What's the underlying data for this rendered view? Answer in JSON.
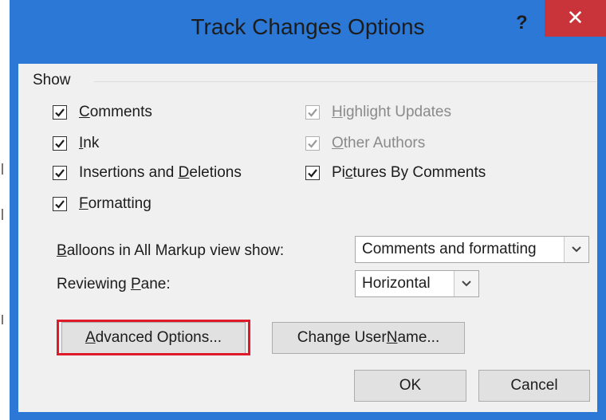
{
  "dialog": {
    "title": "Track Changes Options",
    "help_label": "?",
    "close_label": "✕"
  },
  "show_group": {
    "label": "Show",
    "checkboxes": [
      {
        "pre": "",
        "key": "C",
        "post": "omments",
        "checked": true,
        "enabled": true
      },
      {
        "pre": "",
        "key": "I",
        "post": "nk",
        "checked": true,
        "enabled": true
      },
      {
        "pre": "Insertions and ",
        "key": "D",
        "post": "eletions",
        "checked": true,
        "enabled": true
      },
      {
        "pre": "",
        "key": "F",
        "post": "ormatting",
        "checked": true,
        "enabled": true
      },
      {
        "pre": "",
        "key": "H",
        "post": "ighlight Updates",
        "checked": true,
        "enabled": false
      },
      {
        "pre": "",
        "key": "O",
        "post": "ther Authors",
        "checked": true,
        "enabled": false
      },
      {
        "pre": "Pi",
        "key": "c",
        "post": "tures By Comments",
        "checked": true,
        "enabled": true
      }
    ]
  },
  "balloons": {
    "label_key": "B",
    "label_rest": "alloons in All Markup view show:",
    "value": "Comments and formatting"
  },
  "reviewing_pane": {
    "label_pre": "Reviewing ",
    "label_key": "P",
    "label_post": "ane:",
    "value": "Horizontal"
  },
  "buttons": {
    "advanced": {
      "key": "A",
      "rest": "dvanced Options..."
    },
    "change_user": {
      "pre": "Change User ",
      "key": "N",
      "post": "ame..."
    },
    "ok": "OK",
    "cancel": "Cancel"
  },
  "colors": {
    "titlebar": "#2b78d6",
    "close": "#c9343a",
    "highlight": "#e0192b",
    "client": "#f0f0f0"
  }
}
